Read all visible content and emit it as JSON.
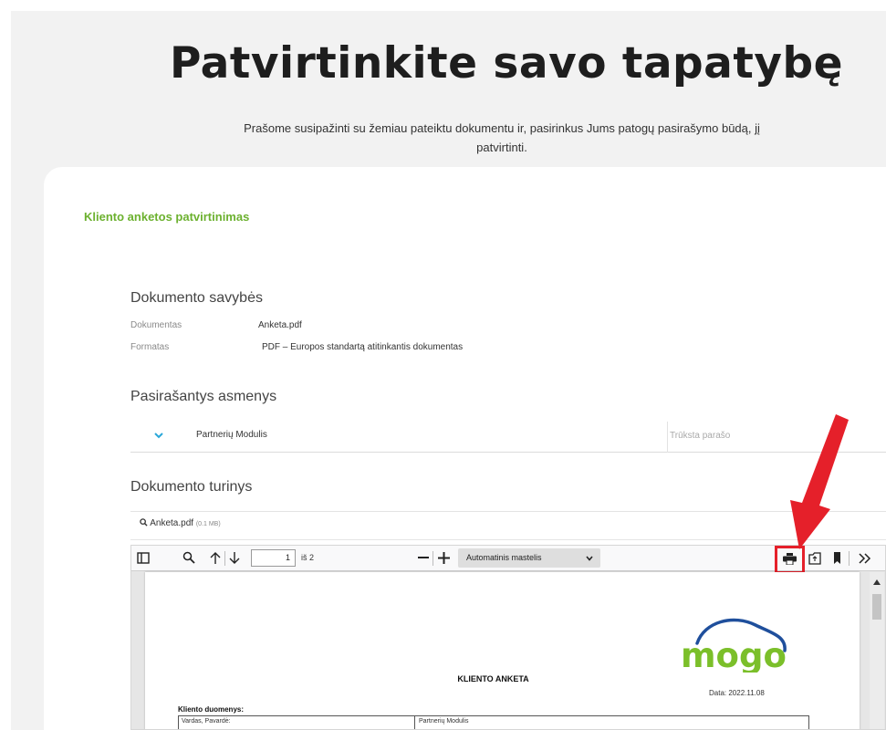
{
  "header": {
    "title": "Patvirtinkite savo tapatybę",
    "subtitle": "Prašome susipažinti su žemiau pateiktu dokumentu ir, pasirinkus Jums patogų pasirašymo būdą, jį patvirtinti."
  },
  "card": {
    "title": "Kliento anketos patvirtinimas"
  },
  "properties": {
    "heading": "Dokumento savybės",
    "rows": [
      {
        "label": "Dokumentas",
        "value": "Anketa.pdf"
      },
      {
        "label": "Formatas",
        "value": "PDF – Europos standartą atitinkantis dokumentas"
      }
    ]
  },
  "signers": {
    "heading": "Pasirašantys asmenys",
    "items": [
      {
        "name": "Partnerių Modulis",
        "status": "Trūksta parašo"
      }
    ]
  },
  "content": {
    "heading": "Dokumento turinys",
    "file_name": "Anketa.pdf",
    "file_size": "(0.1 MB)"
  },
  "viewer": {
    "page_number": "1",
    "page_of": "iš 2",
    "zoom_label": "Automatinis mastelis",
    "icons": [
      "sidebar-toggle-icon",
      "search-icon",
      "arrow-up-icon",
      "arrow-down-icon",
      "zoom-out-icon",
      "zoom-in-icon",
      "print-icon",
      "open-file-icon",
      "bookmark-icon",
      "more-tools-icon"
    ],
    "highlight_color": "#e5202a"
  },
  "pdf": {
    "logo_text": "mogo",
    "heading": "KLIENTO ANKETA",
    "date": "Data: 2022.11.08",
    "section": "Kliento duomenys:",
    "table_row": {
      "label": "Vardas, Pavardė:",
      "value": "Partnerių Modulis"
    }
  },
  "colors": {
    "accent_green": "#6cb12f",
    "annotation_red": "#e5202a"
  }
}
